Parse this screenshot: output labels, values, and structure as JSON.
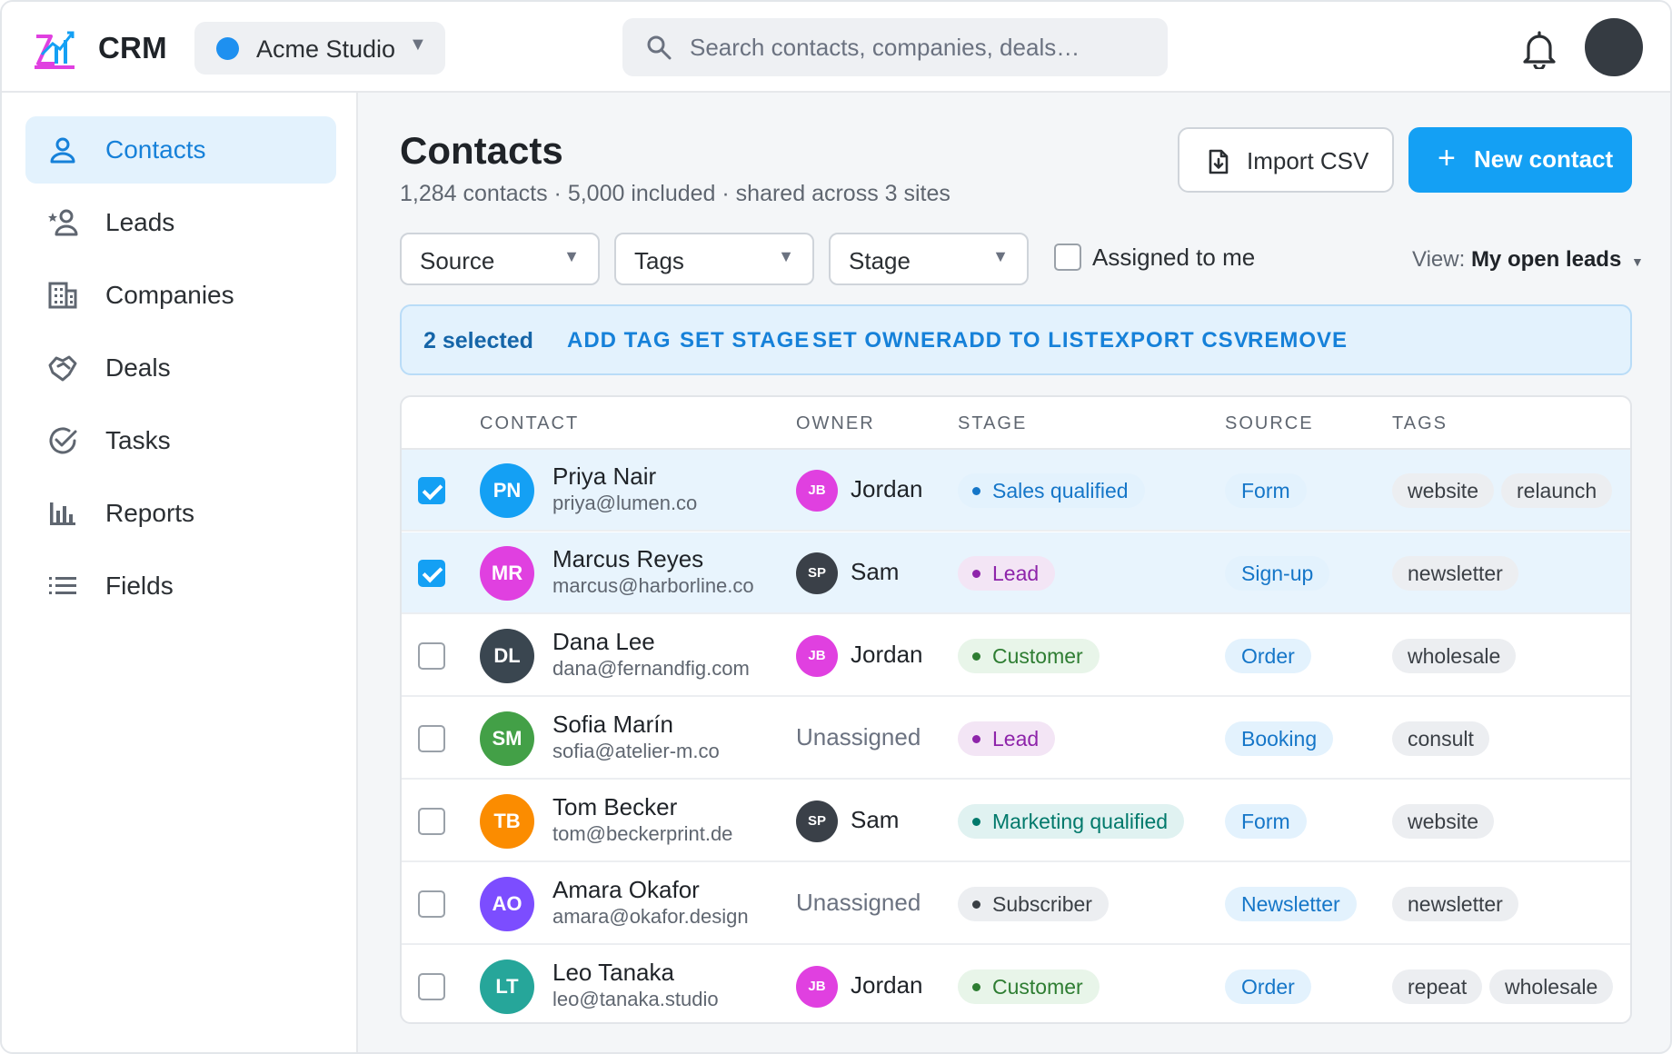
{
  "app": {
    "name": "CRM"
  },
  "workspace": {
    "name": "Acme Studio",
    "color": "#1e90f0"
  },
  "search": {
    "placeholder": "Search contacts, companies, deals…"
  },
  "sidebar": {
    "items": [
      {
        "label": "Contacts",
        "icon": "person-icon",
        "active": true
      },
      {
        "label": "Leads",
        "icon": "star-person-icon"
      },
      {
        "label": "Companies",
        "icon": "building-icon"
      },
      {
        "label": "Deals",
        "icon": "handshake-icon"
      },
      {
        "label": "Tasks",
        "icon": "check-circle-icon"
      },
      {
        "label": "Reports",
        "icon": "bar-chart-icon"
      },
      {
        "label": "Fields",
        "icon": "list-icon"
      }
    ]
  },
  "page": {
    "title": "Contacts",
    "subtitle": "1,284 contacts · 5,000 included · shared across 3 sites",
    "import_label": "Import CSV",
    "new_label": "New contact"
  },
  "filters": {
    "source": "Source",
    "tags": "Tags",
    "stage": "Stage",
    "assigned_label": "Assigned to me",
    "view_prefix": "View:",
    "view_value": "My open leads"
  },
  "bulk": {
    "count": "2 selected",
    "actions": [
      "ADD TAG",
      "SET STAGE",
      "SET OWNER",
      "ADD TO LIST",
      "EXPORT CSV",
      "REMOVE"
    ]
  },
  "table": {
    "columns": [
      "CONTACT",
      "OWNER",
      "STAGE",
      "SOURCE",
      "TAGS"
    ],
    "rows": [
      {
        "selected": true,
        "initials": "PN",
        "avatar_color": "#14a0f4",
        "name": "Priya Nair",
        "email": "priya@lumen.co",
        "owner_initials": "JB",
        "owner": "Jordan",
        "owner_color": "#e040e0",
        "stage": "Sales qualified",
        "stage_style": "sq",
        "source": "Form",
        "tags": [
          "website",
          "relaunch"
        ]
      },
      {
        "selected": true,
        "initials": "MR",
        "avatar_color": "#e040e0",
        "name": "Marcus Reyes",
        "email": "marcus@harborline.co",
        "owner_initials": "SP",
        "owner": "Sam",
        "owner_color": "#3a4048",
        "stage": "Lead",
        "stage_style": "lead",
        "source": "Sign-up",
        "tags": [
          "newsletter"
        ]
      },
      {
        "selected": false,
        "initials": "DL",
        "avatar_color": "#3a4650",
        "name": "Dana Lee",
        "email": "dana@fernandfig.com",
        "owner_initials": "JB",
        "owner": "Jordan",
        "owner_color": "#e040e0",
        "stage": "Customer",
        "stage_style": "cust",
        "source": "Order",
        "tags": [
          "wholesale"
        ]
      },
      {
        "selected": false,
        "initials": "SM",
        "avatar_color": "#43a047",
        "name": "Sofia Marín",
        "email": "sofia@atelier-m.co",
        "owner_initials": "",
        "owner": "Unassigned",
        "owner_color": "",
        "stage": "Lead",
        "stage_style": "lead",
        "source": "Booking",
        "tags": [
          "consult"
        ]
      },
      {
        "selected": false,
        "initials": "TB",
        "avatar_color": "#fb8c00",
        "name": "Tom Becker",
        "email": "tom@beckerprint.de",
        "owner_initials": "SP",
        "owner": "Sam",
        "owner_color": "#3a4048",
        "stage": "Marketing qualified",
        "stage_style": "mq",
        "source": "Form",
        "tags": [
          "website"
        ]
      },
      {
        "selected": false,
        "initials": "AO",
        "avatar_color": "#7c4dff",
        "name": "Amara Okafor",
        "email": "amara@okafor.design",
        "owner_initials": "",
        "owner": "Unassigned",
        "owner_color": "",
        "stage": "Subscriber",
        "stage_style": "sub",
        "source": "Newsletter",
        "tags": [
          "newsletter"
        ]
      },
      {
        "selected": false,
        "initials": "LT",
        "avatar_color": "#26a69a",
        "name": "Leo Tanaka",
        "email": "leo@tanaka.studio",
        "owner_initials": "JB",
        "owner": "Jordan",
        "owner_color": "#e040e0",
        "stage": "Customer",
        "stage_style": "cust",
        "source": "Order",
        "tags": [
          "repeat",
          "wholesale"
        ]
      }
    ]
  },
  "colors": {
    "accent": "#14a0f4",
    "stage_sq_bg": "#e3f2fd",
    "stage_sq_fg": "#1576c8",
    "stage_lead_bg": "#f3e5f5",
    "stage_lead_fg": "#8e24aa",
    "stage_cust_bg": "#e8f5e9",
    "stage_cust_fg": "#2e7d32",
    "stage_mq_bg": "#e0f2f1",
    "stage_mq_fg": "#00796b",
    "stage_sub_bg": "#eceef1",
    "stage_sub_fg": "#3a3f45"
  }
}
